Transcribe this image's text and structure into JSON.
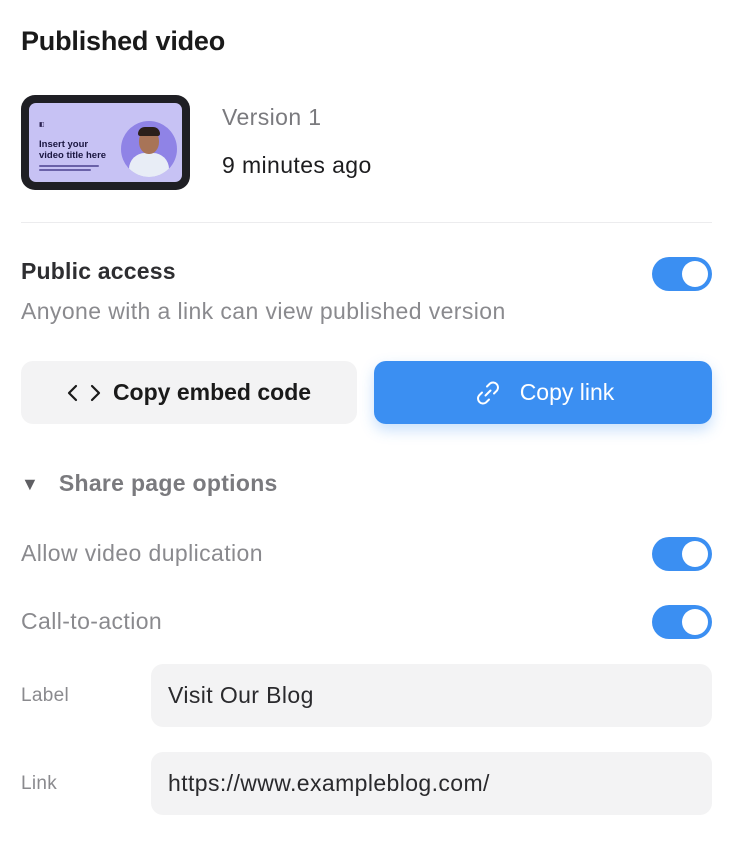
{
  "panel": {
    "title": "Published video"
  },
  "thumbnail": {
    "brand": "Synthesia",
    "headline": "Insert your video title here"
  },
  "version": {
    "label": "Version 1",
    "time": "9 minutes ago"
  },
  "public_access": {
    "title": "Public access",
    "description": "Anyone with a link can view published version",
    "enabled": true
  },
  "buttons": {
    "embed_icon": "‹ ›",
    "embed_label": "Copy embed code",
    "link_label": "Copy link"
  },
  "share_options": {
    "label": "Share page options",
    "expanded": true,
    "allow_duplication_label": "Allow video duplication",
    "allow_duplication_enabled": true,
    "cta_label": "Call-to-action",
    "cta_enabled": true
  },
  "cta_fields": {
    "label_caption": "Label",
    "label_value": "Visit Our Blog",
    "link_caption": "Link",
    "link_value": "https://www.exampleblog.com/"
  },
  "colors": {
    "accent": "#3b8ff2",
    "muted_text": "#8a8a8e",
    "button_bg": "#f3f3f4"
  },
  "icons": {
    "embed": "code-brackets-icon",
    "link": "link-chain-icon",
    "caret": "caret-down-icon"
  }
}
